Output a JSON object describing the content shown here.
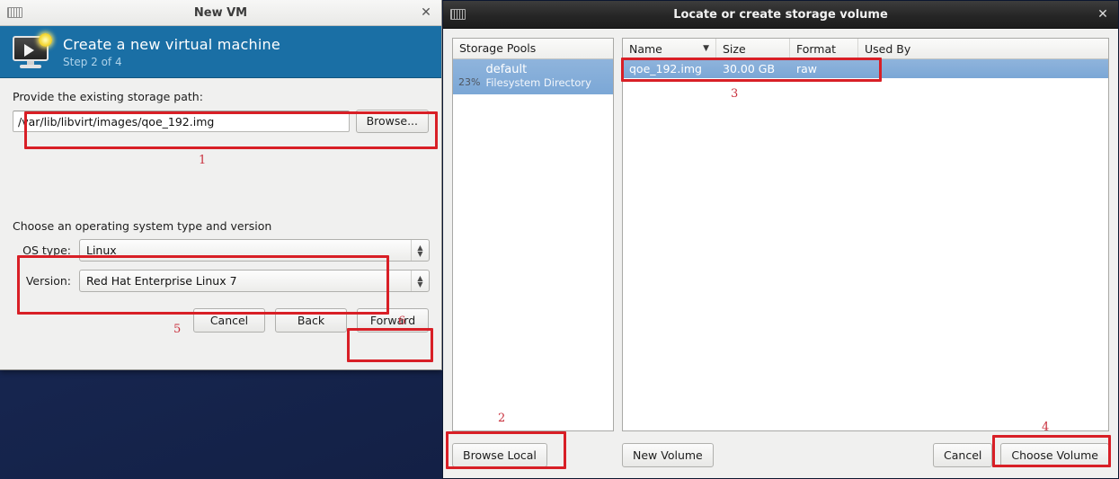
{
  "desktop": {
    "background": "#16264f"
  },
  "new_vm_window": {
    "titlebar": {
      "title": "New VM",
      "close_icon": "close-icon",
      "app_icon": "vm-icon"
    },
    "banner": {
      "title": "Create a new virtual machine",
      "subtitle": "Step 2 of 4",
      "icon": "vm-monitor-play-icon",
      "color": "#1a6fa5"
    },
    "storage_section": {
      "label": "Provide the existing storage path:",
      "path_value": "/var/lib/libvirt/images/qoe_192.img",
      "path_placeholder": "",
      "browse_label": "Browse..."
    },
    "os_section": {
      "label": "Choose an operating system type and version",
      "rows": [
        {
          "label": "OS type:",
          "value": "Linux"
        },
        {
          "label": "Version:",
          "value": "Red Hat Enterprise Linux 7"
        }
      ]
    },
    "actions": {
      "cancel_label": "Cancel",
      "back_label": "Back",
      "forward_label": "Forward"
    }
  },
  "storage_window": {
    "titlebar": {
      "title": "Locate or create storage volume",
      "close_icon": "close-icon",
      "app_icon": "vm-icon"
    },
    "pools": {
      "header": "Storage Pools",
      "items": [
        {
          "percent": "23%",
          "name": "default",
          "type": "Filesystem Directory"
        }
      ]
    },
    "volumes": {
      "columns": [
        {
          "key": "name",
          "label": "Name",
          "sort_icon": "chevron-down-icon"
        },
        {
          "key": "size",
          "label": "Size"
        },
        {
          "key": "format",
          "label": "Format"
        },
        {
          "key": "used_by",
          "label": "Used By"
        }
      ],
      "rows": [
        {
          "name": "qoe_192.img",
          "size": "30.00 GB",
          "format": "raw",
          "used_by": ""
        }
      ]
    },
    "footer": {
      "browse_local_label": "Browse Local",
      "new_volume_label": "New Volume",
      "cancel_label": "Cancel",
      "choose_volume_label": "Choose Volume"
    }
  },
  "annotations": {
    "color": "#d81f26",
    "numbers": [
      "1",
      "2",
      "3",
      "4",
      "5",
      "6"
    ]
  }
}
